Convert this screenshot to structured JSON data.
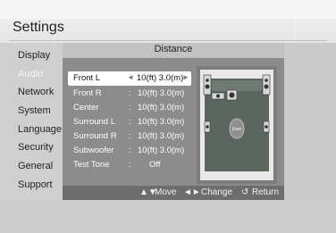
{
  "header": {
    "title": "Settings"
  },
  "sidebar": {
    "items": [
      {
        "label": "Display"
      },
      {
        "label": "Audio"
      },
      {
        "label": "Network"
      },
      {
        "label": "System"
      },
      {
        "label": "Language"
      },
      {
        "label": "Security"
      },
      {
        "label": "General"
      },
      {
        "label": "Support"
      }
    ]
  },
  "dialog": {
    "title": "Distance",
    "rows": [
      {
        "label": "Front L",
        "separator": ":",
        "value": "10(ft) 3.0(m)"
      },
      {
        "label": "Front R",
        "separator": ":",
        "value": "10(ft) 3.0(m)"
      },
      {
        "label": "Center",
        "separator": ":",
        "value": "10(ft) 3.0(m)"
      },
      {
        "label": "Surround L",
        "separator": ":",
        "value": "10(ft) 3.0(m)"
      },
      {
        "label": "Surround R",
        "separator": ":",
        "value": "10(ft) 3.0(m)"
      },
      {
        "label": "Subwoofer",
        "separator": ":",
        "value": "10(ft) 3.0(m)"
      },
      {
        "label": "Test Tone",
        "separator": ":",
        "value": "Off"
      }
    ],
    "selected_arrows": {
      "left": "◄",
      "right": "►"
    },
    "listener_label": "User",
    "footer": {
      "move_icon": "▲▼",
      "move_label": "Move",
      "change_icon": "◄►",
      "change_label": "Change",
      "return_icon": "↺",
      "return_label": "Return"
    }
  },
  "colors": {
    "panel_bg": "#8c8c8c",
    "selected_bg": "#ffffff",
    "active_sidebar_text": "#f5f5f5"
  }
}
